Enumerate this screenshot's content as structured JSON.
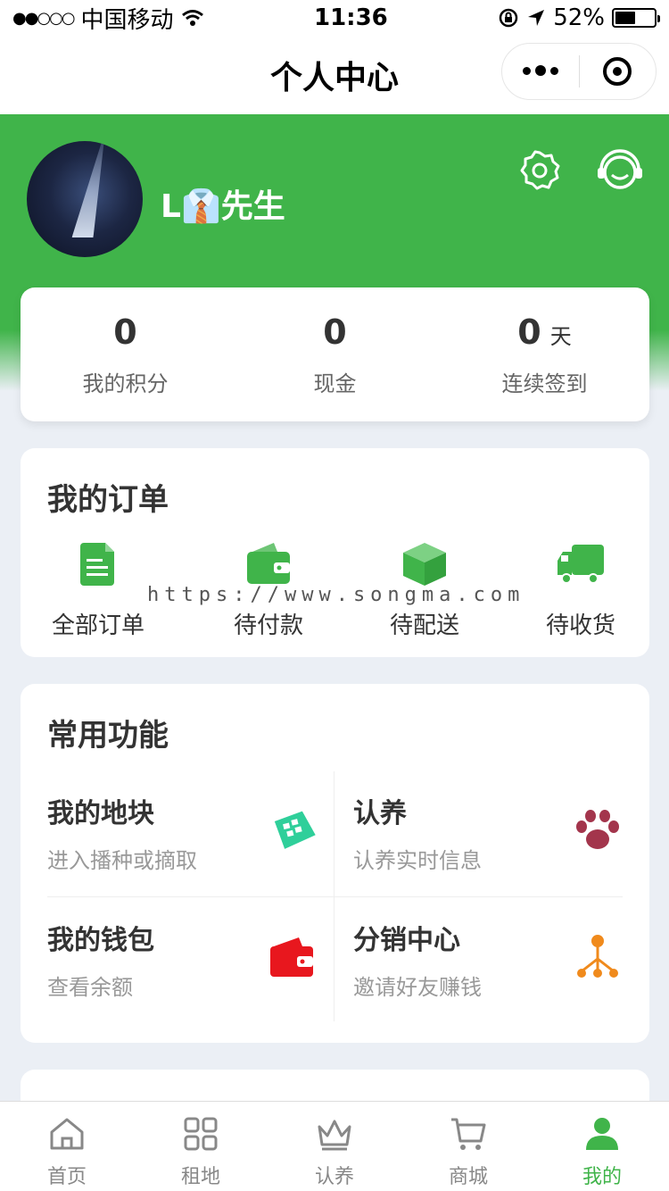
{
  "status_bar": {
    "carrier": "中国移动",
    "time": "11:36",
    "battery": "52%",
    "battery_level": 0.52
  },
  "nav": {
    "title": "个人中心"
  },
  "profile": {
    "name": "L👔先生"
  },
  "stats": [
    {
      "value": "0",
      "label": "我的积分",
      "unit": ""
    },
    {
      "value": "0",
      "label": "现金",
      "unit": ""
    },
    {
      "value": "0",
      "label": "连续签到",
      "unit": "天"
    }
  ],
  "orders": {
    "title": "我的订单",
    "items": [
      {
        "label": "全部订单",
        "icon": "document-icon"
      },
      {
        "label": "待付款",
        "icon": "wallet-icon"
      },
      {
        "label": "待配送",
        "icon": "box-icon"
      },
      {
        "label": "待收货",
        "icon": "truck-icon"
      }
    ]
  },
  "watermark": "https://www.songma.com",
  "features": {
    "title": "常用功能",
    "items": [
      {
        "title": "我的地块",
        "subtitle": "进入播种或摘取",
        "icon": "plot-grid-icon"
      },
      {
        "title": "认养",
        "subtitle": "认养实时信息",
        "icon": "paw-icon"
      },
      {
        "title": "我的钱包",
        "subtitle": "查看余额",
        "icon": "wallet-icon"
      },
      {
        "title": "分销中心",
        "subtitle": "邀请好友赚钱",
        "icon": "network-icon"
      }
    ]
  },
  "tabbar": [
    {
      "label": "首页",
      "icon": "home-icon"
    },
    {
      "label": "租地",
      "icon": "grid-icon"
    },
    {
      "label": "认养",
      "icon": "crown-icon"
    },
    {
      "label": "商城",
      "icon": "cart-icon"
    },
    {
      "label": "我的",
      "icon": "user-icon",
      "active": true
    }
  ],
  "colors": {
    "brand_green": "#40b44a",
    "background": "#ebeff5",
    "wallet_red": "#e8171e",
    "paw_red": "#a3354c",
    "network_orange": "#f08a1c",
    "plot_teal": "#2fcf9a"
  }
}
